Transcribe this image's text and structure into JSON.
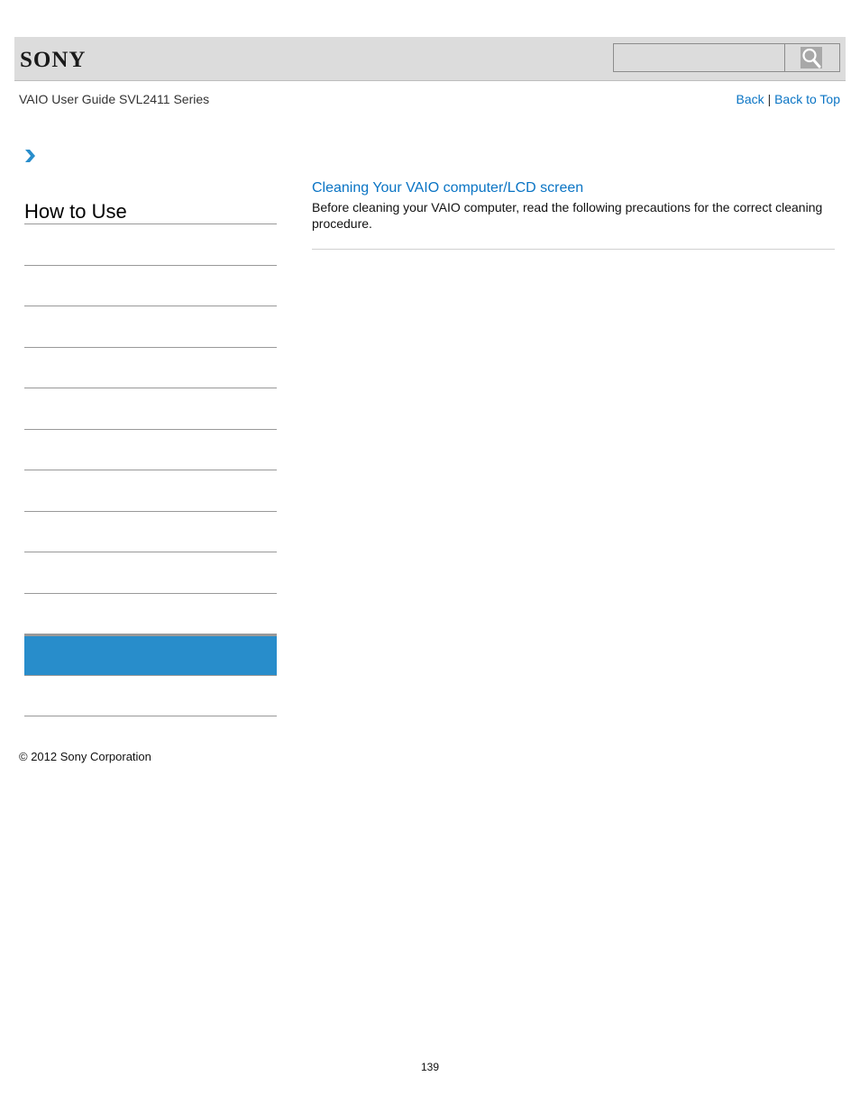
{
  "header": {
    "logo_text": "SONY",
    "search": {
      "value": "",
      "placeholder": ""
    },
    "search_button_icon": "search-icon"
  },
  "guide_title": "VAIO User Guide SVL2411 Series",
  "top_links": {
    "back_label": "Back",
    "separator": "|",
    "back_to_top_label": "Back to Top"
  },
  "breadcrumb_icon": "chevron-right-icon",
  "sidebar": {
    "title": "How to Use",
    "items": [
      {
        "label": "",
        "active": false
      },
      {
        "label": "",
        "active": false
      },
      {
        "label": "",
        "active": false
      },
      {
        "label": "",
        "active": false
      },
      {
        "label": "",
        "active": false
      },
      {
        "label": "",
        "active": false
      },
      {
        "label": "",
        "active": false
      },
      {
        "label": "",
        "active": false
      },
      {
        "label": "",
        "active": false
      },
      {
        "label": "",
        "active": false
      },
      {
        "label": "",
        "active": true
      },
      {
        "label": "",
        "active": false
      }
    ]
  },
  "content": {
    "article_title": "Cleaning Your VAIO computer/LCD screen",
    "article_description": "Before cleaning your VAIO computer, read the following precautions for the correct cleaning procedure."
  },
  "footer": {
    "copyright": "© 2012 Sony Corporation",
    "page_number": "139"
  },
  "colors": {
    "accent_link": "#0a74c4",
    "active_item": "#288dcb",
    "header_bg": "#dcdcdc"
  }
}
